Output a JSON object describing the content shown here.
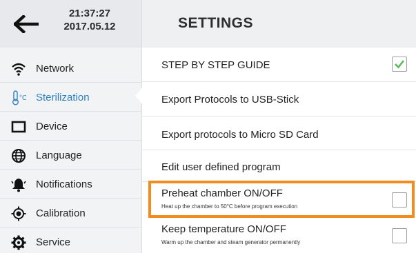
{
  "header": {
    "time": "21:37:27",
    "date": "2017.05.12",
    "title": "SETTINGS"
  },
  "sidebar": {
    "items": [
      {
        "label": "Network",
        "icon": "wifi-icon",
        "active": false
      },
      {
        "label": "Sterilization",
        "icon": "thermometer-celsius-icon",
        "active": true
      },
      {
        "label": "Device",
        "icon": "device-icon",
        "active": false
      },
      {
        "label": "Language",
        "icon": "globe-icon",
        "active": false
      },
      {
        "label": "Notifications",
        "icon": "bell-icon",
        "active": false
      },
      {
        "label": "Calibration",
        "icon": "calibration-icon",
        "active": false
      },
      {
        "label": "Service",
        "icon": "gear-icon",
        "active": false
      }
    ]
  },
  "settings": {
    "step_guide": {
      "label": "STEP BY STEP GUIDE",
      "checked": true
    },
    "export_usb": {
      "label": "Export Protocols to USB-Stick"
    },
    "export_sd": {
      "label": "Export protocols to Micro SD Card"
    },
    "edit_program": {
      "label": "Edit user defined program"
    },
    "preheat": {
      "label": "Preheat chamber ON/OFF",
      "description": "Heat up the chamber to 50°C before program execution",
      "checked": false
    },
    "keep_temp": {
      "label": "Keep temperature ON/OFF",
      "description": "Warm up the chamber and steam generator permanently",
      "checked": false
    }
  },
  "colors": {
    "accent": "#2f7fbf",
    "highlight": "#f28c1e",
    "check": "#5cb85c"
  }
}
